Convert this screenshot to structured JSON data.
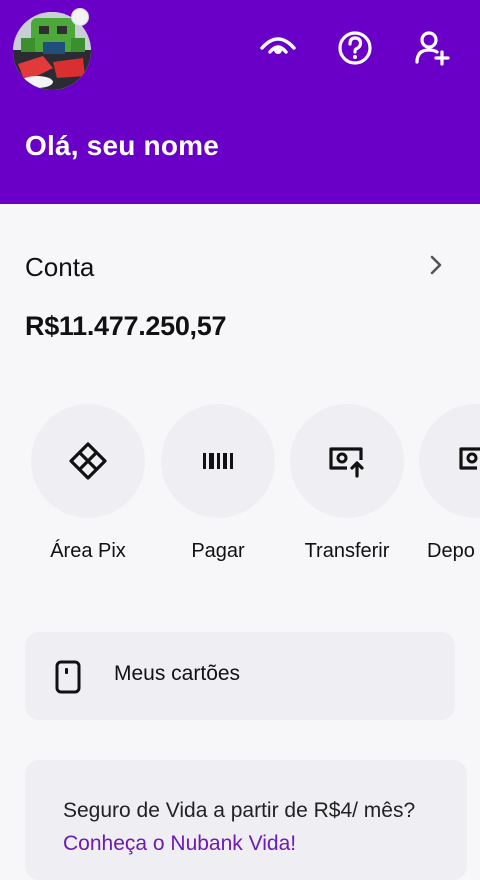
{
  "header": {
    "greeting": "Olá, seu nome",
    "icons": [
      "eye-icon",
      "help-icon",
      "add-user-icon"
    ]
  },
  "account": {
    "label": "Conta",
    "balance": "R$11.477.250,57"
  },
  "actions": [
    {
      "label": "Área Pix",
      "icon": "pix-icon"
    },
    {
      "label": "Pagar",
      "icon": "barcode-icon"
    },
    {
      "label": "Transferir",
      "icon": "transfer-icon"
    },
    {
      "label": "Depo",
      "icon": "deposit-icon"
    }
  ],
  "cards": {
    "label": "Meus cartões"
  },
  "promo": {
    "text": "Seguro de Vida a partir de R$4/ mês?",
    "link": "Conheça o Nubank Vida!"
  },
  "colors": {
    "brand": "#6a00c8",
    "surface": "#efeef2",
    "link": "#6a1bb8"
  }
}
